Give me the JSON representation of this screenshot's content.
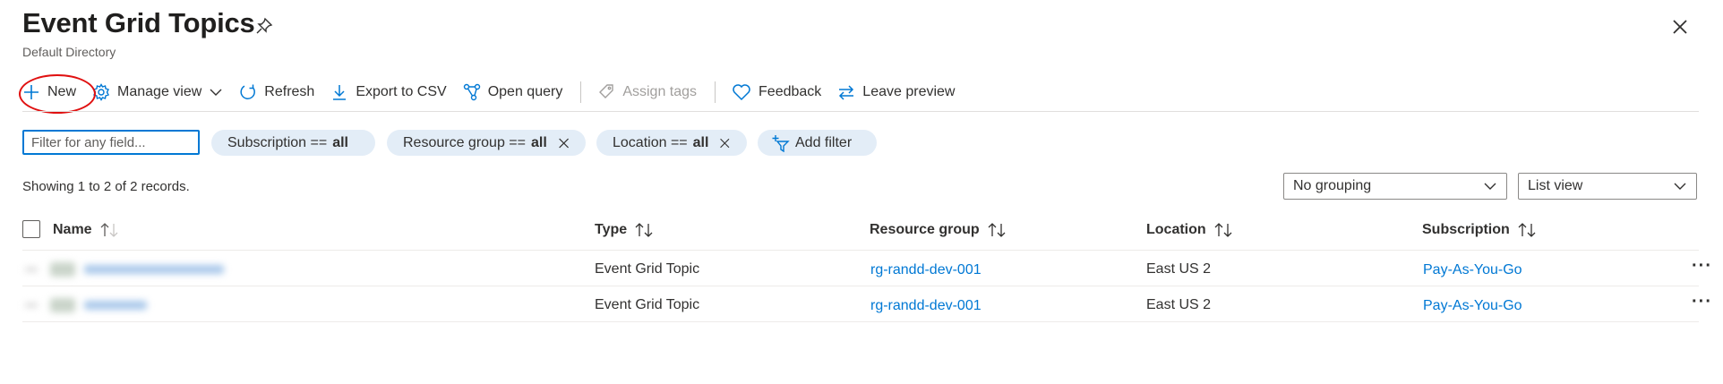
{
  "header": {
    "title": "Event Grid Topics",
    "subtitle": "Default Directory"
  },
  "toolbar": {
    "new_label": "New",
    "manage_view_label": "Manage view",
    "refresh_label": "Refresh",
    "export_label": "Export to CSV",
    "open_query_label": "Open query",
    "assign_tags_label": "Assign tags",
    "feedback_label": "Feedback",
    "leave_preview_label": "Leave preview"
  },
  "filters": {
    "search_placeholder": "Filter for any field...",
    "subscription": {
      "label": "Subscription ==",
      "value": "all"
    },
    "resource_group": {
      "label": "Resource group ==",
      "value": "all"
    },
    "location": {
      "label": "Location ==",
      "value": "all"
    },
    "add_filter_label": "Add filter"
  },
  "records_text": "Showing 1 to 2 of 2 records.",
  "grouping": {
    "selected": "No grouping"
  },
  "view": {
    "selected": "List view"
  },
  "table": {
    "columns": {
      "name": "Name",
      "type": "Type",
      "resource_group": "Resource group",
      "location": "Location",
      "subscription": "Subscription"
    },
    "rows": [
      {
        "type": "Event Grid Topic",
        "resource_group": "rg-randd-dev-001",
        "location": "East US 2",
        "subscription": "Pay-As-You-Go"
      },
      {
        "type": "Event Grid Topic",
        "resource_group": "rg-randd-dev-001",
        "location": "East US 2",
        "subscription": "Pay-As-You-Go"
      }
    ]
  },
  "colors": {
    "accent": "#0078d4",
    "pill_bg": "#e3edf7",
    "annotation": "#e01010"
  }
}
